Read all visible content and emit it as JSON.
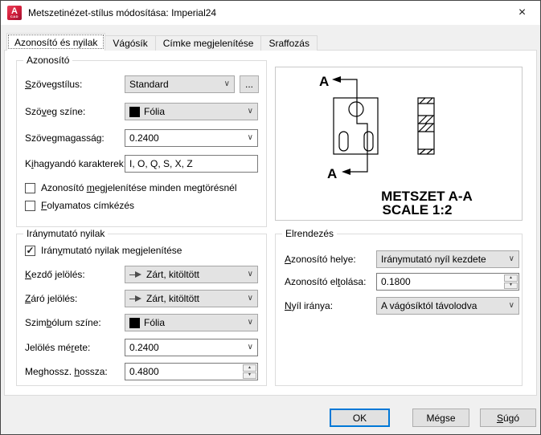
{
  "window": {
    "title": "Metszetinézet-stílus módosítása: Imperial24",
    "icon_letter": "A",
    "icon_sub": "CAD"
  },
  "icons": {
    "close": "×",
    "chevron": "∨",
    "spin_up": "▲",
    "spin_down": "▼",
    "check": "✓"
  },
  "tabs": [
    {
      "label": "Azonosító és nyilak",
      "active": true
    },
    {
      "label": "Vágósík",
      "active": false
    },
    {
      "label": "Címke megjelenítése",
      "active": false
    },
    {
      "label": "Sraffozás",
      "active": false
    }
  ],
  "identifier": {
    "title": "Azonosító",
    "text_style": {
      "label": {
        "text": "Szövegstílus:",
        "u": 0
      },
      "value": "Standard",
      "browse_label": "..."
    },
    "text_color": {
      "label": {
        "text": "Szöveg színe:",
        "u": 3
      },
      "value": "Fólia",
      "swatch": "#000000"
    },
    "text_height": {
      "label": {
        "text": "Szövegmagasság:",
        "u": 8
      },
      "value": "0.2400"
    },
    "exclude_chars": {
      "label": {
        "text": "Kihagyandó karakterek:",
        "u": 1
      },
      "value": "I, O, Q, S, X, Z"
    },
    "show_at_breaks": {
      "label": {
        "text": "Azonosító megjelenítése minden megtörésnél",
        "u": 10
      },
      "checked": false
    },
    "continuous_labeling": {
      "label": {
        "text": "Folyamatos címkézés",
        "u": 0
      },
      "checked": false
    }
  },
  "direction_arrows": {
    "title": "Iránymutató nyilak",
    "show_arrows": {
      "label": {
        "text": "Iránymutató nyilak megjelenítése",
        "u": 4
      },
      "checked": true
    },
    "start_symbol": {
      "label": {
        "text": "Kezdő jelölés:",
        "u": 0
      },
      "value": "Zárt, kitöltött",
      "icon": "filled-arrow"
    },
    "end_symbol": {
      "label": {
        "text": "Záró jelölés:",
        "u": 0
      },
      "value": "Zárt, kitöltött",
      "icon": "filled-arrow"
    },
    "symbol_color": {
      "label": {
        "text": "Szimbólum színe:",
        "u": 4
      },
      "value": "Fólia",
      "swatch": "#000000"
    },
    "symbol_size": {
      "label": {
        "text": "Jelölés mérete:",
        "u": 10
      },
      "value": "0.2400"
    },
    "extension_length": {
      "label": {
        "text": "Meghossz. hossza:",
        "u": 10
      },
      "value": "0.4800"
    }
  },
  "arrangement": {
    "title": "Elrendezés",
    "identifier_position": {
      "label": {
        "text": "Azonosító helye:",
        "u": 0
      },
      "value": "Iránymutató nyíl kezdete"
    },
    "identifier_offset": {
      "label": {
        "text": "Azonosító eltolása:",
        "u": 12
      },
      "value": "0.1800"
    },
    "arrow_direction": {
      "label": {
        "text": "Nyíl iránya:",
        "u": 0
      },
      "value": "A vágósíktól távolodva"
    }
  },
  "preview": {
    "label_top": "A",
    "label_bottom": "A",
    "section_title": "METSZET A-A",
    "section_scale": "SCALE 1:2"
  },
  "footer": {
    "ok": {
      "text": "OK"
    },
    "cancel": {
      "text": "Mégse"
    },
    "help": {
      "text": "Súgó",
      "u": 0
    }
  },
  "colors": {
    "focus_accent": "#0078d7",
    "swatch_black": "#000000",
    "titlebar_bg": "#ffffff",
    "dialog_bg": "#f0f0f0"
  }
}
